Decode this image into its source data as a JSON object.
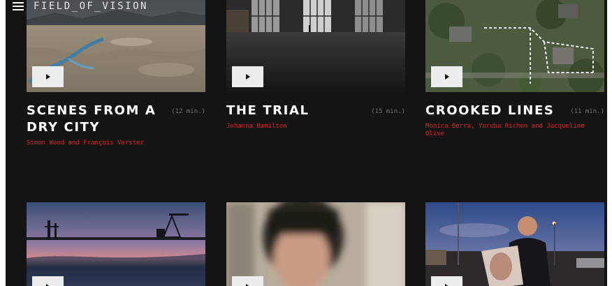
{
  "header": {
    "logo": "FIELD_OF_VISION"
  },
  "films": [
    {
      "title": "SCENES FROM A DRY CITY",
      "duration": "(12 min.)",
      "credits": "Simon Wood and François Verster"
    },
    {
      "title": "THE TRIAL",
      "duration": "(15 min.)",
      "credits": "Johanna Hamilton"
    },
    {
      "title": "CROOKED LINES",
      "duration": "(11 min.)",
      "credits": "Monica Berra, Yoruba Richen and Jacqueline Olive"
    }
  ],
  "colors": {
    "background": "#141414",
    "accent_red": "#e02424",
    "title_white": "#ffffff",
    "muted_gray": "#6f6f6f"
  },
  "icons": [
    "hamburger-menu-icon",
    "play-icon"
  ]
}
